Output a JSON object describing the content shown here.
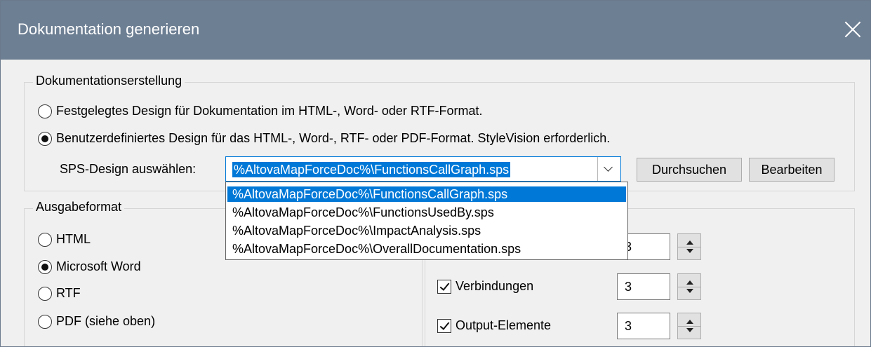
{
  "window": {
    "title": "Dokumentation generieren"
  },
  "doc_creation": {
    "legend": "Dokumentationserstellung",
    "option_fixed": "Festgelegtes Design für Dokumentation im HTML-, Word- oder RTF-Format.",
    "option_custom": "Benutzerdefiniertes Design für das HTML-, Word-, RTF- oder PDF-Format. StyleVision erforderlich.",
    "selected_option": "custom",
    "sps_label": "SPS-Design auswählen:",
    "sps_value": "%AltovaMapForceDoc%\\FunctionsCallGraph.sps",
    "sps_options": [
      "%AltovaMapForceDoc%\\FunctionsCallGraph.sps",
      "%AltovaMapForceDoc%\\FunctionsUsedBy.sps",
      "%AltovaMapForceDoc%\\ImpactAnalysis.sps",
      "%AltovaMapForceDoc%\\OverallDocumentation.sps"
    ],
    "browse_button": "Durchsuchen",
    "edit_button": "Bearbeiten"
  },
  "output_format": {
    "legend": "Ausgabeformat",
    "options": [
      "HTML",
      "Microsoft Word",
      "RTF",
      "PDF (siehe oben)"
    ],
    "selected": "Microsoft Word"
  },
  "depth": {
    "rows": [
      {
        "label": "",
        "checked": true,
        "value": "3"
      },
      {
        "label": "Verbindungen",
        "checked": true,
        "value": "3"
      },
      {
        "label": "Output-Elemente",
        "checked": true,
        "value": "3"
      }
    ]
  },
  "colors": {
    "titlebar": "#6d7f93",
    "selection": "#0078d7",
    "dialog_bg": "#f0f0f0"
  }
}
